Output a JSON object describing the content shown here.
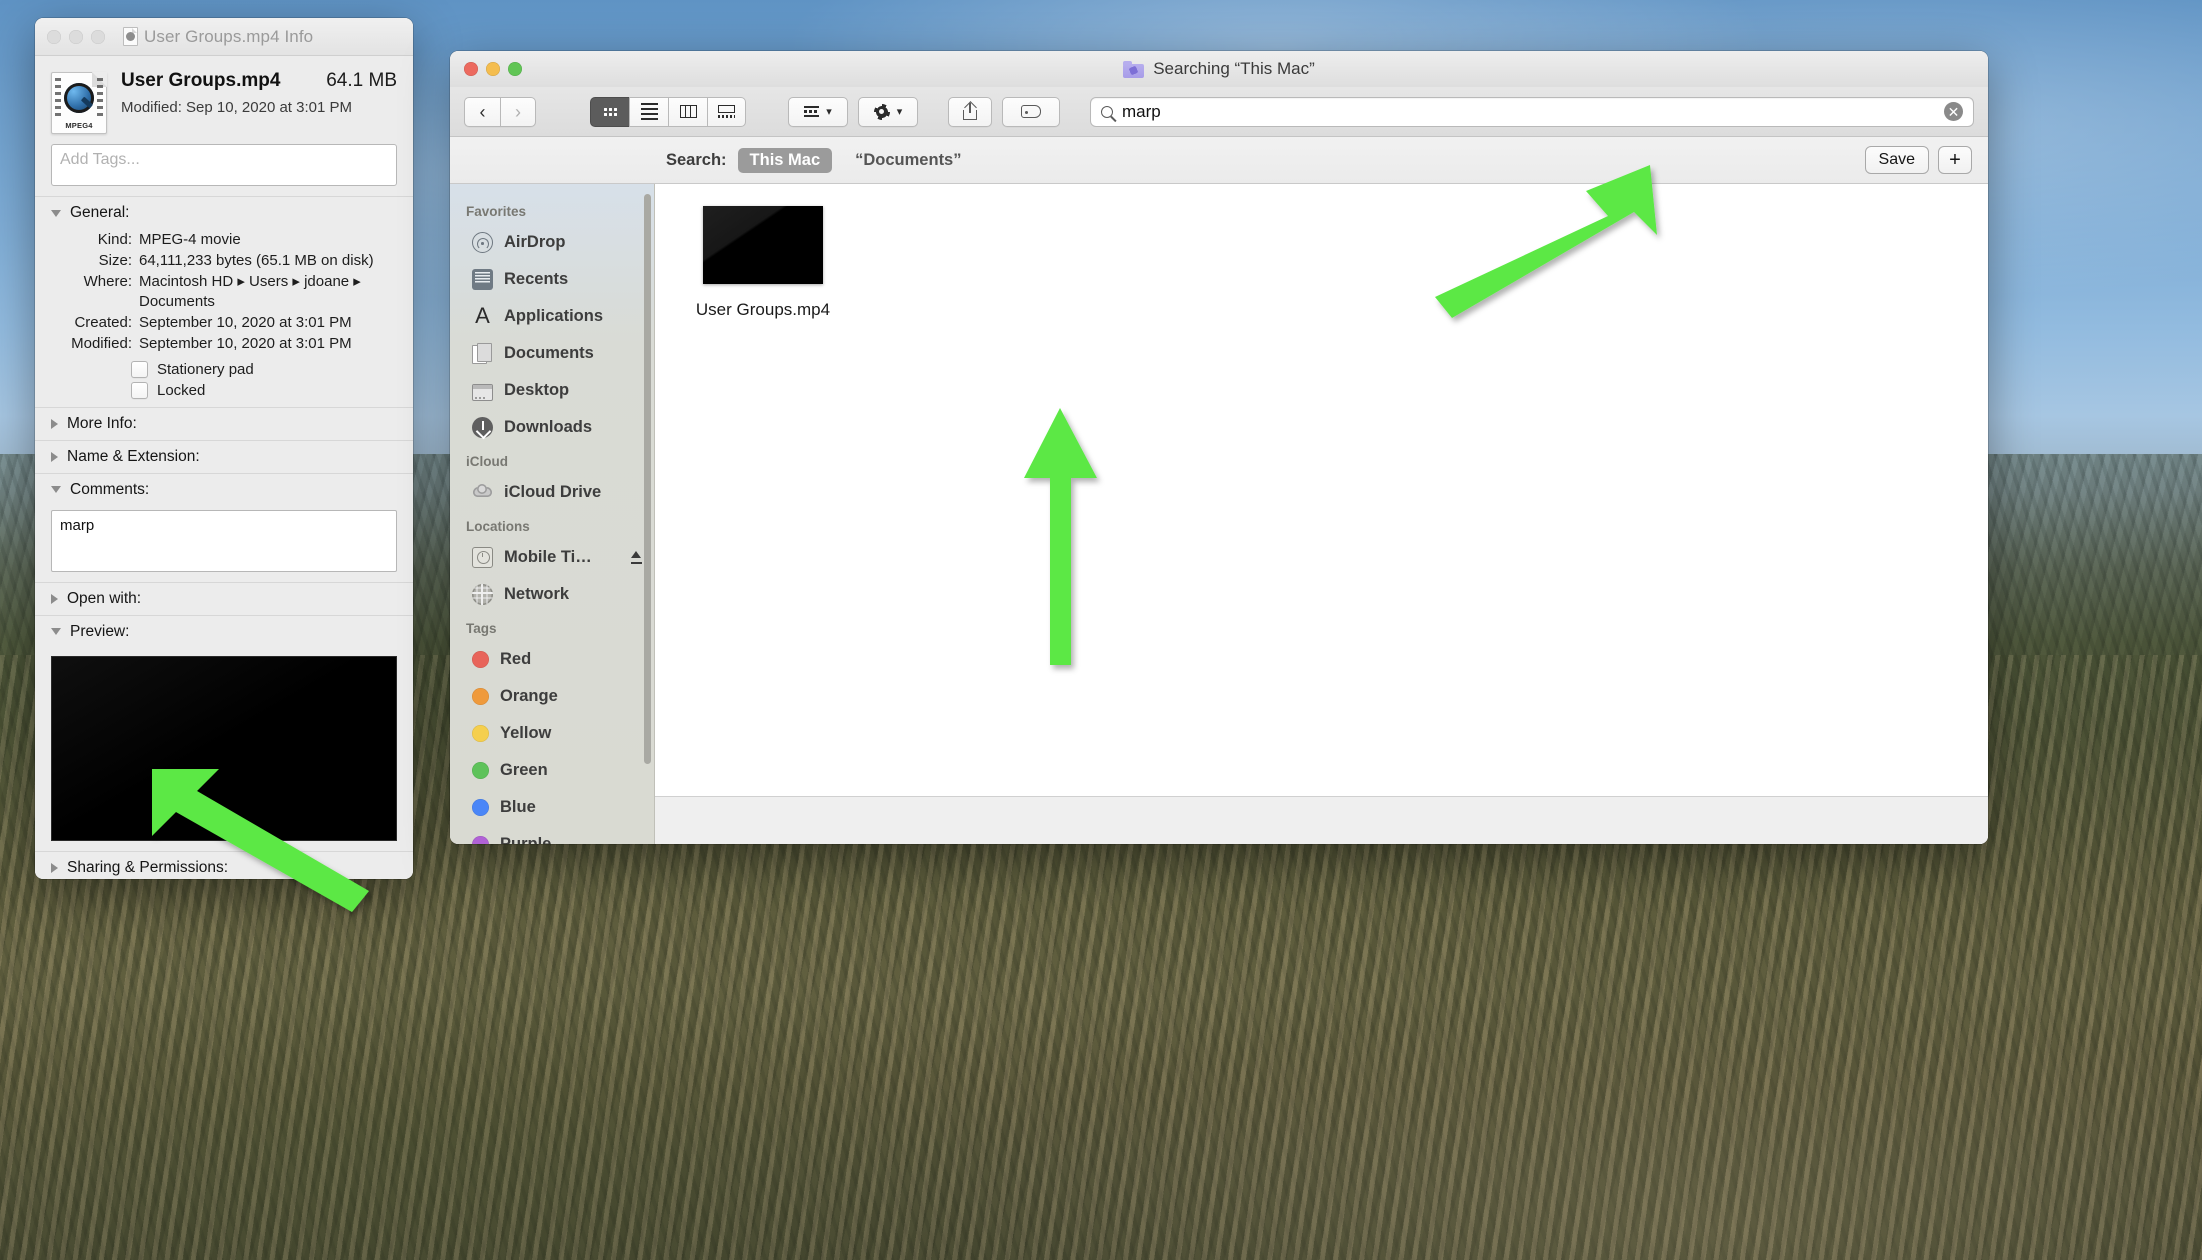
{
  "info_window": {
    "title": "User Groups.mp4 Info",
    "title_icon": "mp4-document-icon",
    "file_name": "User Groups.mp4",
    "file_size_header": "64.1 MB",
    "modified_header_label": "Modified:",
    "modified_header_value": "Sep 10, 2020 at 3:01 PM",
    "tags_placeholder": "Add Tags...",
    "icon_badge_label": "MPEG4",
    "sections": {
      "general": "General:",
      "more_info": "More Info:",
      "name_extension": "Name & Extension:",
      "comments": "Comments:",
      "open_with": "Open with:",
      "preview": "Preview:",
      "sharing_permissions": "Sharing & Permissions:"
    },
    "general": [
      {
        "key": "Kind:",
        "value": "MPEG-4 movie"
      },
      {
        "key": "Size:",
        "value": "64,111,233 bytes (65.1 MB on disk)"
      },
      {
        "key": "Where:",
        "value": "Macintosh HD ▸ Users ▸ jdoane ▸ Documents"
      },
      {
        "key": "Created:",
        "value": "September 10, 2020 at 3:01 PM"
      },
      {
        "key": "Modified:",
        "value": "September 10, 2020 at 3:01 PM"
      }
    ],
    "checkboxes": [
      {
        "label": "Stationery pad",
        "checked": false
      },
      {
        "label": "Locked",
        "checked": false
      }
    ],
    "comments_value": "marp"
  },
  "finder_window": {
    "title": "Searching “This Mac”",
    "title_icon": "smart-folder-icon",
    "toolbar": {
      "back_label": "‹",
      "forward_label": "›",
      "view_modes": [
        {
          "name": "icon-view",
          "selected": true
        },
        {
          "name": "list-view",
          "selected": false
        },
        {
          "name": "column-view",
          "selected": false
        },
        {
          "name": "gallery-view",
          "selected": false
        }
      ],
      "arrange_icon": "arrange-icon",
      "action_icon": "gear-icon",
      "share_icon": "share-icon",
      "tag_icon": "tag-icon"
    },
    "search": {
      "value": "marp",
      "search_icon": "search-icon",
      "clear_icon": "clear-icon",
      "clear_glyph": "✕"
    },
    "search_bar": {
      "label": "Search:",
      "scopes": [
        {
          "label": "This Mac",
          "selected": true
        },
        {
          "label": "“Documents”",
          "selected": false
        }
      ],
      "save_label": "Save",
      "add_label": "+"
    },
    "sidebar": {
      "sections": [
        {
          "title": "Favorites",
          "items": [
            {
              "label": "AirDrop",
              "icon": "airdrop-icon"
            },
            {
              "label": "Recents",
              "icon": "recents-icon"
            },
            {
              "label": "Applications",
              "icon": "applications-icon"
            },
            {
              "label": "Documents",
              "icon": "documents-icon"
            },
            {
              "label": "Desktop",
              "icon": "desktop-icon"
            },
            {
              "label": "Downloads",
              "icon": "downloads-icon"
            }
          ]
        },
        {
          "title": "iCloud",
          "items": [
            {
              "label": "iCloud Drive",
              "icon": "icloud-icon"
            }
          ]
        },
        {
          "title": "Locations",
          "items": [
            {
              "label": "Mobile Ti…",
              "icon": "hard-drive-icon",
              "eject": true
            },
            {
              "label": "Network",
              "icon": "network-icon"
            }
          ]
        },
        {
          "title": "Tags",
          "items": [
            {
              "label": "Red",
              "icon": "tag-dot",
              "color": "#e8645a"
            },
            {
              "label": "Orange",
              "icon": "tag-dot",
              "color": "#ef9a3c"
            },
            {
              "label": "Yellow",
              "icon": "tag-dot",
              "color": "#f5cf4e"
            },
            {
              "label": "Green",
              "icon": "tag-dot",
              "color": "#5ec25a"
            },
            {
              "label": "Blue",
              "icon": "tag-dot",
              "color": "#4a86f7"
            },
            {
              "label": "Purple",
              "icon": "tag-dot",
              "color": "#b162d6"
            }
          ]
        }
      ]
    },
    "results": [
      {
        "label": "User Groups.mp4",
        "thumb": "black-video-thumbnail"
      }
    ]
  },
  "annotations": {
    "arrow_color": "#5ce845",
    "arrows": [
      {
        "name": "arrow-to-search-field",
        "points_at": "search-input"
      },
      {
        "name": "arrow-to-search-result",
        "points_at": "result-item"
      },
      {
        "name": "arrow-to-comments-field",
        "points_at": "comments-field"
      }
    ]
  }
}
